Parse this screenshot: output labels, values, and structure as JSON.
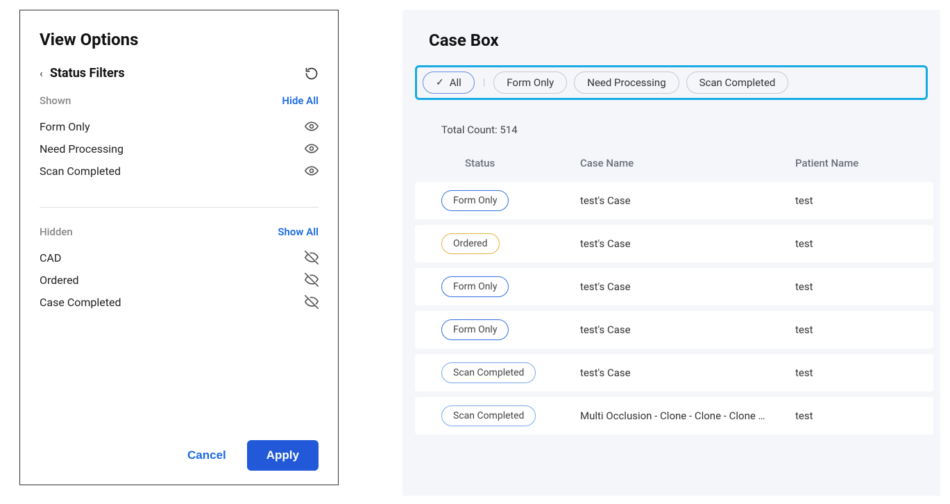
{
  "viewOptions": {
    "title": "View Options",
    "statusFiltersLabel": "Status Filters",
    "shownLabel": "Shown",
    "hideAllLabel": "Hide All",
    "hiddenLabel": "Hidden",
    "showAllLabel": "Show All",
    "cancelLabel": "Cancel",
    "applyLabel": "Apply",
    "shownItems": [
      {
        "label": "Form Only"
      },
      {
        "label": "Need Processing"
      },
      {
        "label": "Scan Completed"
      }
    ],
    "hiddenItems": [
      {
        "label": "CAD"
      },
      {
        "label": "Ordered"
      },
      {
        "label": "Case Completed"
      }
    ]
  },
  "caseBox": {
    "title": "Case Box",
    "totalCountLabel": "Total Count: 514",
    "chips": [
      {
        "label": "All",
        "selected": true
      },
      {
        "label": "Form Only",
        "selected": false
      },
      {
        "label": "Need Processing",
        "selected": false
      },
      {
        "label": "Scan Completed",
        "selected": false
      }
    ],
    "columns": {
      "status": "Status",
      "caseName": "Case Name",
      "patientName": "Patient Name"
    },
    "statusColors": {
      "Form Only": "#2f6fe3",
      "Ordered": "#e1b33a",
      "Scan Completed": "#7aa7e8"
    },
    "rows": [
      {
        "status": "Form Only",
        "caseName": "test's Case",
        "patientName": "test"
      },
      {
        "status": "Ordered",
        "caseName": "test's Case",
        "patientName": "test"
      },
      {
        "status": "Form Only",
        "caseName": "test's Case",
        "patientName": "test"
      },
      {
        "status": "Form Only",
        "caseName": "test's Case",
        "patientName": "test"
      },
      {
        "status": "Scan Completed",
        "caseName": "test's Case",
        "patientName": "test"
      },
      {
        "status": "Scan Completed",
        "caseName": "Multi Occlusion - Clone - Clone - Clone …",
        "patientName": "test"
      }
    ]
  }
}
